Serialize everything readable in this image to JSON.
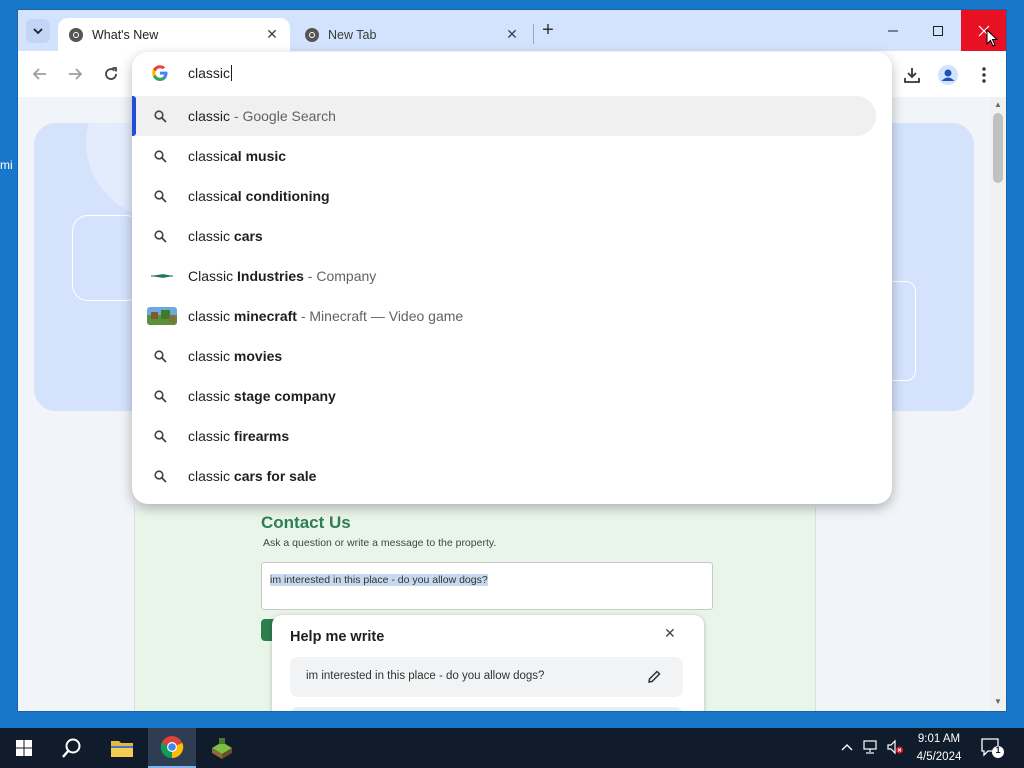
{
  "desktop": {
    "left_text": "mi"
  },
  "tabs": [
    {
      "title": "What's New",
      "active": true
    },
    {
      "title": "New Tab",
      "active": false
    }
  ],
  "omnibox": {
    "query": "classic",
    "suggestions": [
      {
        "prefix": "classic",
        "bold": "",
        "desc": " - Google Search",
        "icon": "search-icon",
        "selected": true
      },
      {
        "prefix": "classic",
        "bold": "al music",
        "desc": "",
        "icon": "search-icon"
      },
      {
        "prefix": "classic",
        "bold": "al conditioning",
        "desc": "",
        "icon": "search-icon"
      },
      {
        "prefix": "classic ",
        "bold": "cars",
        "desc": "",
        "icon": "search-icon"
      },
      {
        "prefix": "Classic ",
        "bold": "Industries",
        "desc": " - Company",
        "icon": "company-logo-thumbnail"
      },
      {
        "prefix": "classic ",
        "bold": "minecraft",
        "desc": " - Minecraft — Video game",
        "icon": "minecraft-thumbnail"
      },
      {
        "prefix": "classic ",
        "bold": "movies",
        "desc": "",
        "icon": "search-icon"
      },
      {
        "prefix": "classic ",
        "bold": "stage company",
        "desc": "",
        "icon": "search-icon"
      },
      {
        "prefix": "classic ",
        "bold": "firearms",
        "desc": "",
        "icon": "search-icon"
      },
      {
        "prefix": "classic ",
        "bold": "cars for sale",
        "desc": "",
        "icon": "search-icon"
      }
    ]
  },
  "page": {
    "contact_title": "Contact Us",
    "contact_subtitle": "Ask a question or write a message to the property.",
    "message_text": "im interested in this place - do you allow dogs?"
  },
  "help_me_write": {
    "title": "Help me write",
    "prompt": "im interested in this place - do you allow dogs?"
  },
  "taskbar": {
    "time": "9:01 AM",
    "date": "4/5/2024",
    "notification_count": "1"
  },
  "colors": {
    "desktop": "#1877c9",
    "tabstrip": "#d3e3fd",
    "close_button": "#e81123",
    "selection_bar": "#1f4ed8",
    "contact_green": "#2f7d55",
    "taskbar": "#101b2b"
  }
}
